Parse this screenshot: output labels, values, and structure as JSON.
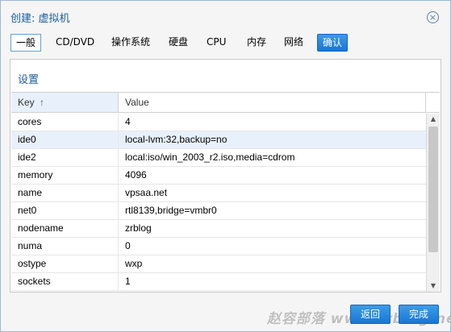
{
  "window": {
    "title": "创建: 虚拟机",
    "close_icon": "close-icon"
  },
  "tabs": [
    {
      "label": "一般",
      "state": "active"
    },
    {
      "label": "CD/DVD",
      "state": "normal"
    },
    {
      "label": "操作系统",
      "state": "normal"
    },
    {
      "label": "硬盘",
      "state": "normal"
    },
    {
      "label": "CPU",
      "state": "normal"
    },
    {
      "label": "内存",
      "state": "normal"
    },
    {
      "label": "网络",
      "state": "normal"
    },
    {
      "label": "确认",
      "state": "primary"
    }
  ],
  "panel": {
    "title": "设置",
    "grid": {
      "columns": {
        "key": "Key",
        "key_sort_icon": "↑",
        "value": "Value"
      },
      "rows": [
        {
          "key": "cores",
          "value": "4",
          "selected": false
        },
        {
          "key": "ide0",
          "value": "local-lvm:32,backup=no",
          "selected": true
        },
        {
          "key": "ide2",
          "value": "local:iso/win_2003_r2.iso,media=cdrom",
          "selected": false
        },
        {
          "key": "memory",
          "value": "4096",
          "selected": false
        },
        {
          "key": "name",
          "value": "vpsaa.net",
          "selected": false
        },
        {
          "key": "net0",
          "value": "rtl8139,bridge=vmbr0",
          "selected": false
        },
        {
          "key": "nodename",
          "value": "zrblog",
          "selected": false
        },
        {
          "key": "numa",
          "value": "0",
          "selected": false
        },
        {
          "key": "ostype",
          "value": "wxp",
          "selected": false
        },
        {
          "key": "sockets",
          "value": "1",
          "selected": false
        }
      ]
    }
  },
  "footer": {
    "back_label": "返回",
    "finish_label": "完成",
    "watermark": "赵容部落 www.zrblog.net"
  },
  "colors": {
    "accent": "#1b5d9c",
    "primary_button": "#1e88e5",
    "selected_row": "#e8f1fb"
  }
}
